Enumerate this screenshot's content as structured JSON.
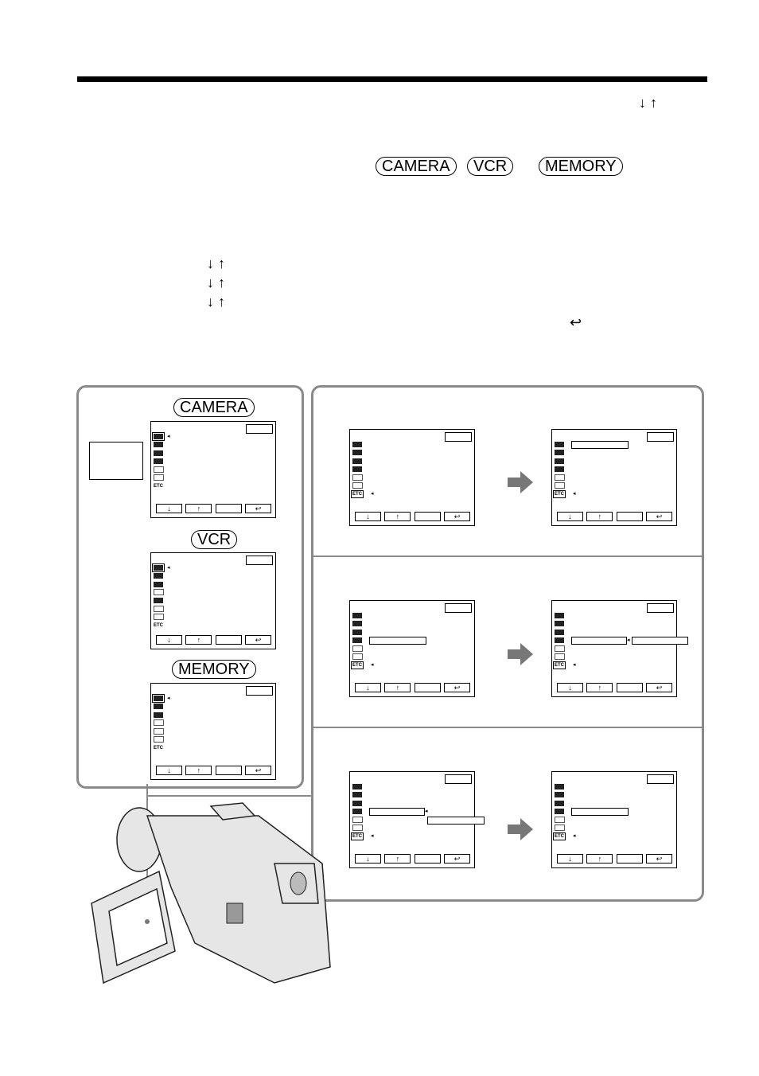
{
  "header": {
    "arrow_down_up": "↓ ↑",
    "mode_labels": [
      "CAMERA",
      "VCR",
      "MEMORY"
    ]
  },
  "steps": {
    "arrows": [
      "↓ ↑",
      "↓ ↑",
      "↓ ↑"
    ],
    "return_icon": "↩"
  },
  "left_panel": {
    "modes": [
      {
        "label": "CAMERA",
        "icons": [
          "manual-icon",
          "camera-set-icon",
          "lcd-vf-icon",
          "cm-set-icon",
          "tape-set-icon",
          "setup-icon",
          "ETC"
        ]
      },
      {
        "label": "VCR",
        "icons": [
          "manual-icon",
          "vcr-set-icon",
          "lcd-vf-icon",
          "memory-icon",
          "cm-set-icon",
          "tape-set-icon",
          "setup-icon",
          "ETC"
        ]
      },
      {
        "label": "MEMORY",
        "icons": [
          "manual-icon",
          "camera-set-icon",
          "lcd-vf-icon",
          "memory-icon",
          "memory-play-icon",
          "setup-icon",
          "ETC"
        ]
      }
    ]
  },
  "lcd": {
    "buttons": [
      "↓",
      "↑",
      "",
      "↩"
    ],
    "etc_label": "ETC",
    "pointer": "◂"
  }
}
